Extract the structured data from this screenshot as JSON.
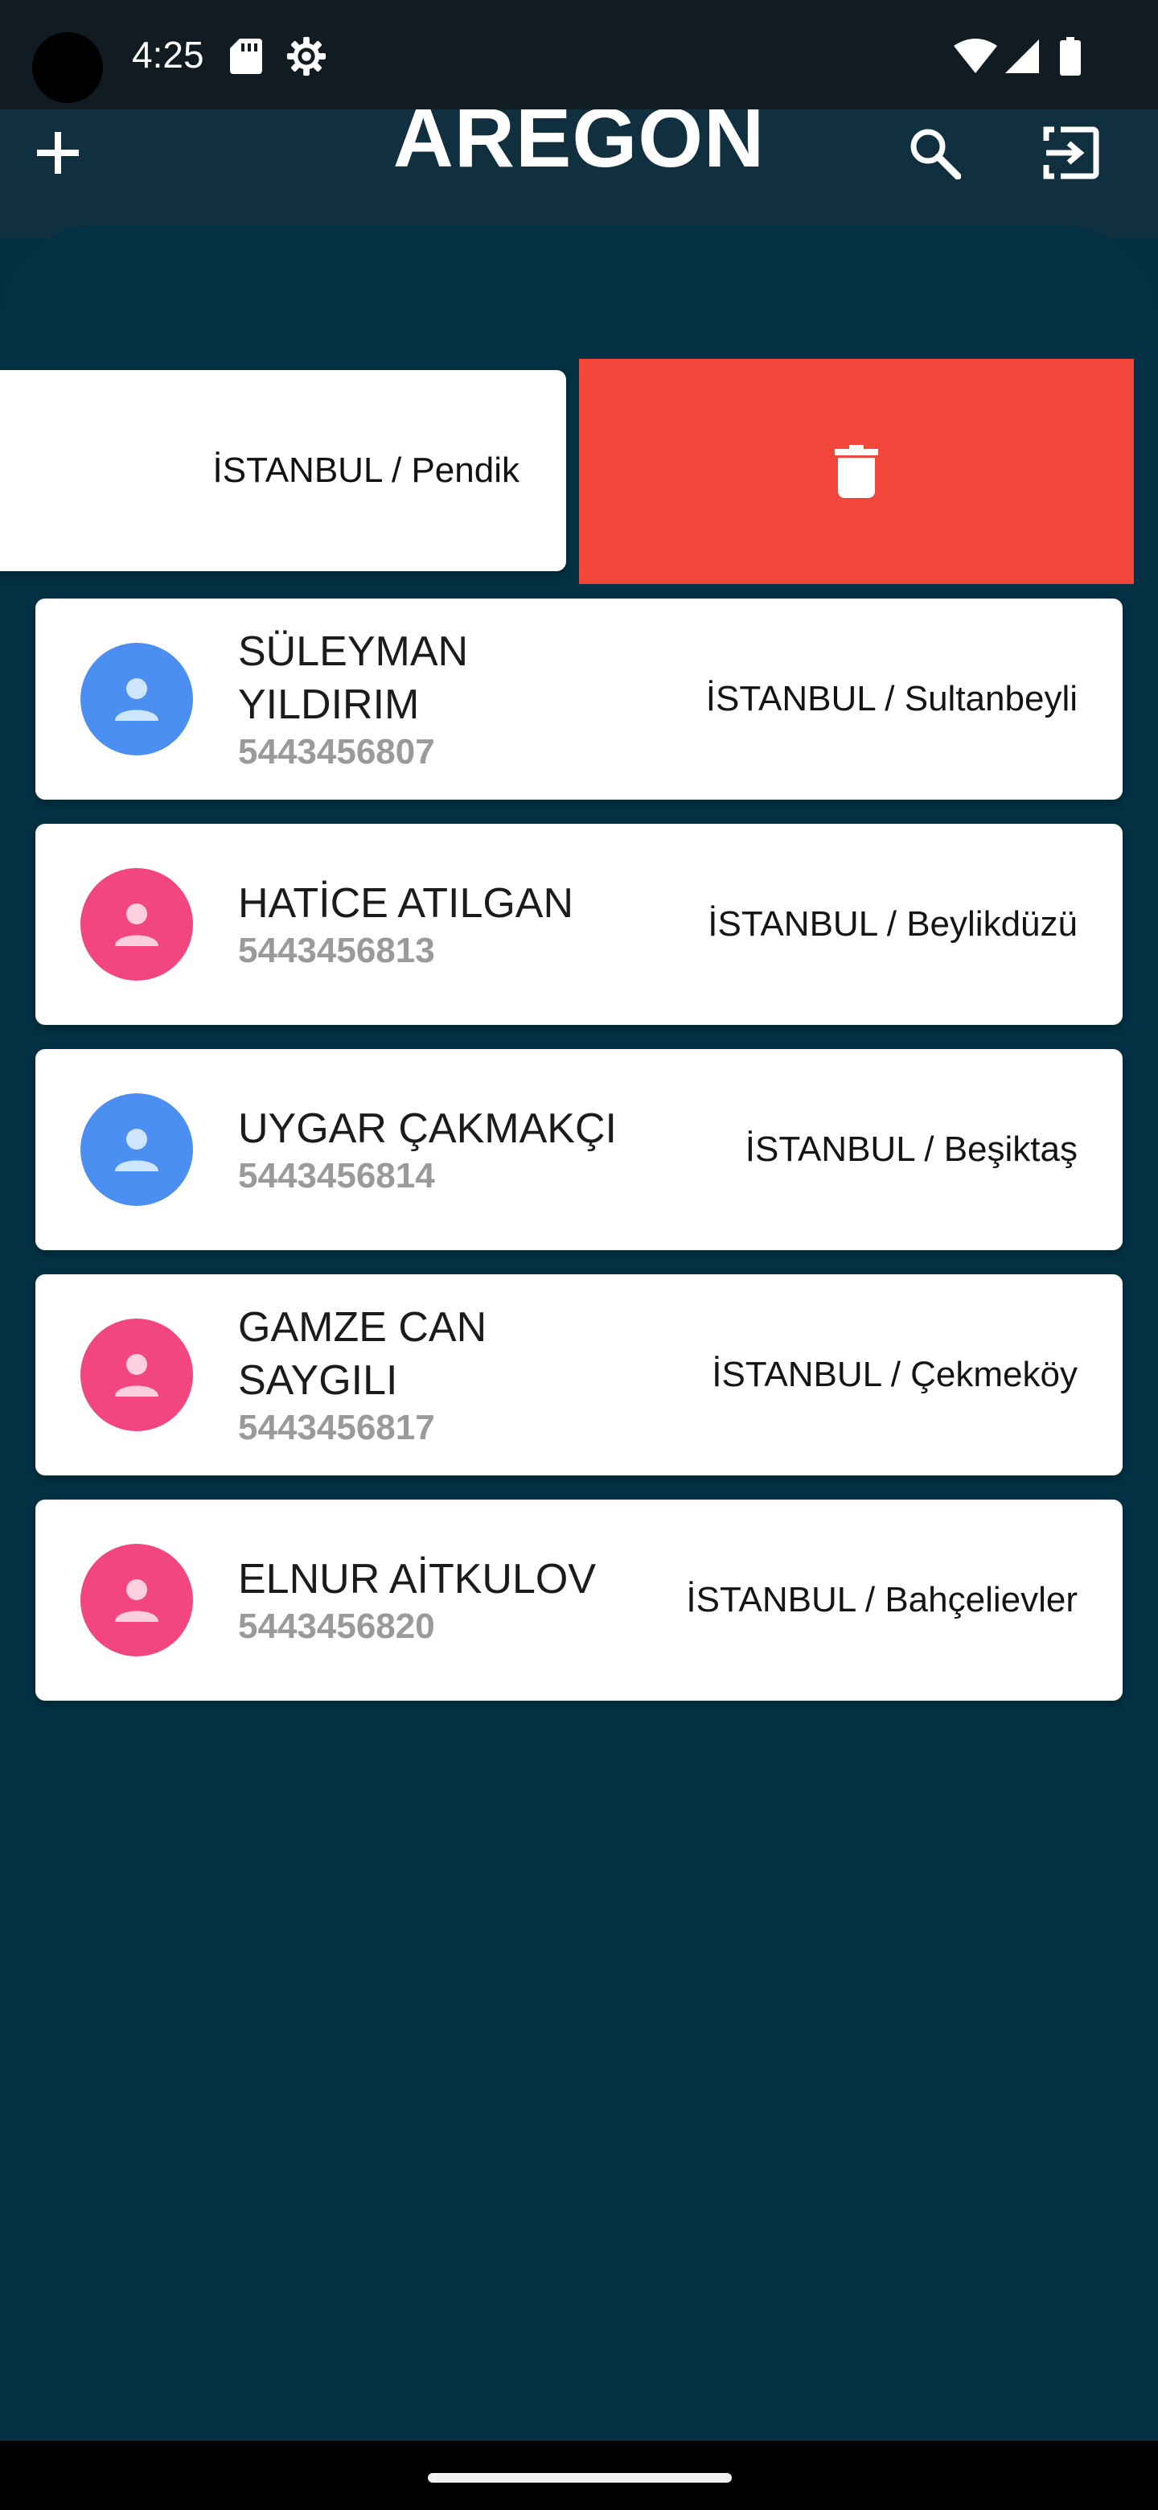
{
  "status_bar": {
    "time": "4:25",
    "icons": [
      "sd-card-icon",
      "settings-gear-icon",
      "wifi-icon",
      "cell-signal-icon",
      "battery-icon"
    ]
  },
  "header": {
    "title": "AREGON",
    "add_icon": "plus-icon",
    "search_icon": "search-icon",
    "logout_icon": "logout-icon"
  },
  "swiped_item": {
    "city": "İSTANBUL / Pendik",
    "action_icon": "trash-icon",
    "action_color": "#f3463b"
  },
  "contacts": [
    {
      "name": "SÜLEYMAN YILDIRIM",
      "phone": "5443456807",
      "city": "İSTANBUL / Sultanbeyli",
      "gender": "male"
    },
    {
      "name": "HATİCE ATILGAN",
      "phone": "5443456813",
      "city": "İSTANBUL / Beylikdüzü",
      "gender": "female"
    },
    {
      "name": "UYGAR ÇAKMAKÇI",
      "phone": "5443456814",
      "city": "İSTANBUL / Beşiktaş",
      "gender": "male"
    },
    {
      "name": "GAMZE CAN SAYGILI",
      "phone": "5443456817",
      "city": "İSTANBUL / Çekmeköy",
      "gender": "female"
    },
    {
      "name": "ELNUR AİTKULOV",
      "phone": "5443456820",
      "city": "İSTANBUL / Bahçelievler",
      "gender": "female"
    }
  ],
  "colors": {
    "background": "#033043",
    "header": "#102f3f",
    "avatar_male": "#4c8ff3",
    "avatar_female": "#f3467e",
    "delete": "#f3463b",
    "phone_text": "#9a9a9a"
  }
}
